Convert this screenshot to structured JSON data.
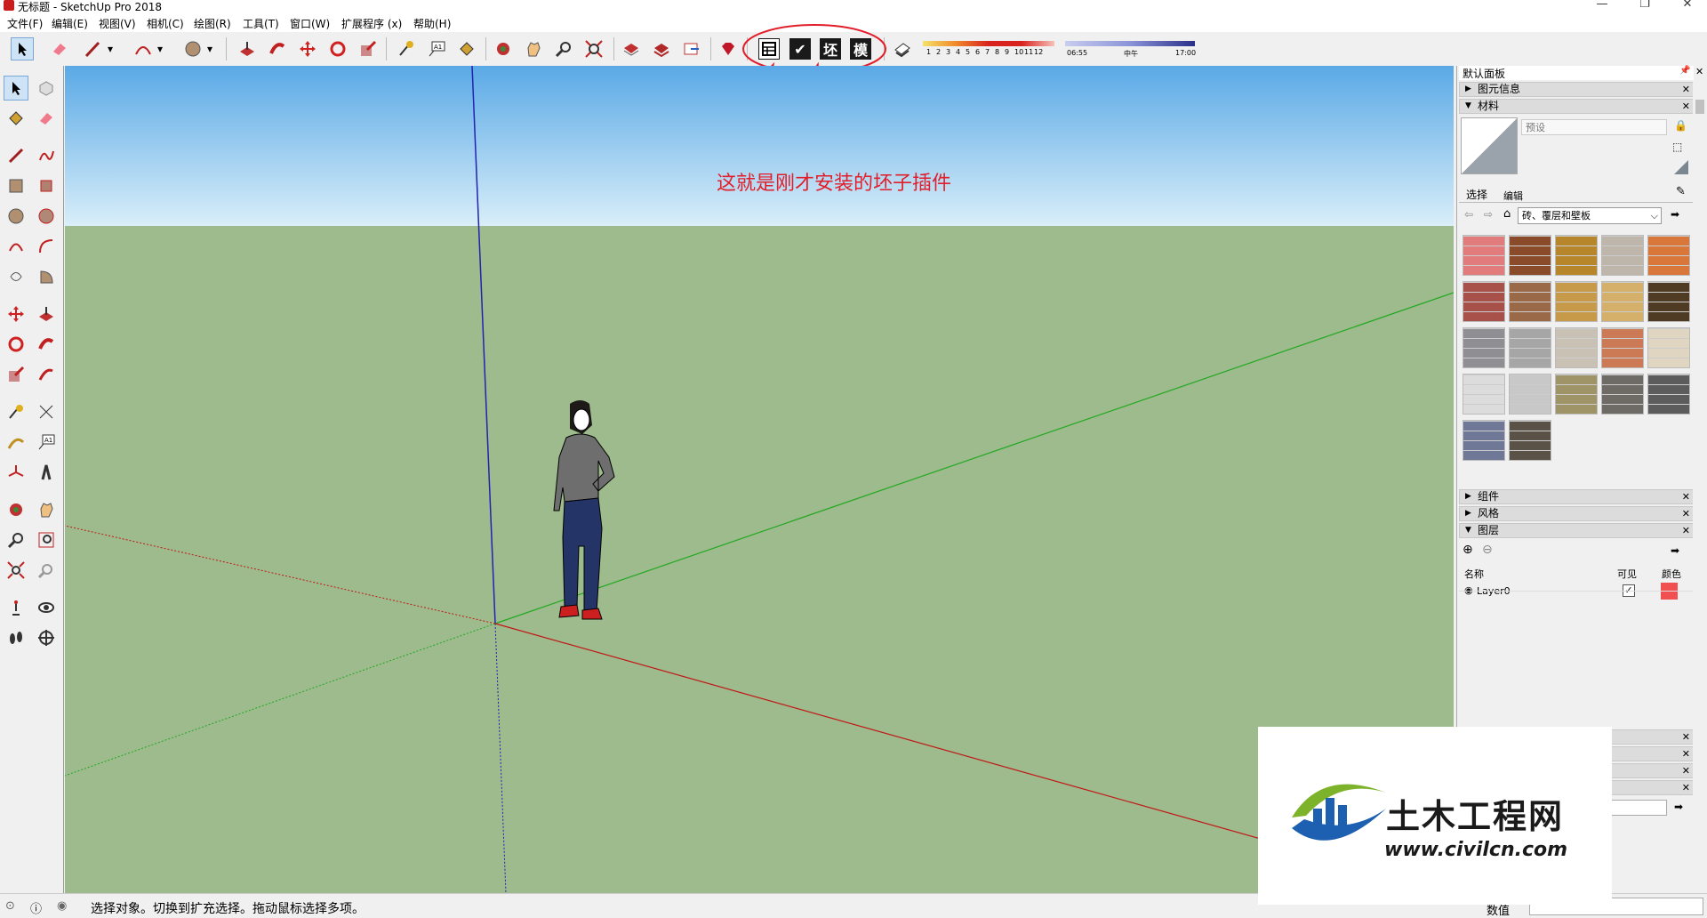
{
  "window": {
    "title": "无标题 - SketchUp Pro 2018"
  },
  "menubar": {
    "items": [
      "文件(F)",
      "编辑(E)",
      "视图(V)",
      "相机(C)",
      "绘图(R)",
      "工具(T)",
      "窗口(W)",
      "扩展程序 (x)",
      "帮助(H)"
    ]
  },
  "toolbar": {
    "plugin_buttons": [
      "坯",
      "模"
    ],
    "shadow_months": [
      "1",
      "2",
      "3",
      "4",
      "5",
      "6",
      "7",
      "8",
      "9",
      "10",
      "11",
      "12"
    ],
    "shadow_time_start": "06:55",
    "shadow_time_mid": "中午",
    "shadow_time_end": "17:00"
  },
  "annotation": {
    "text": "这就是刚才安装的坯子插件",
    "color": "#e21e2a"
  },
  "tray": {
    "title": "默认面板",
    "entity_info": "图元信息",
    "materials": {
      "title": "材料",
      "name_placeholder": "预设",
      "tab_select": "选择",
      "tab_edit": "编辑",
      "library": "砖、覆层和壁板"
    },
    "components": "组件",
    "styles": "风格",
    "layers": {
      "title": "图层",
      "col_name": "名称",
      "col_visible": "可见",
      "col_color": "颜色",
      "rows": [
        {
          "name": "Layer0",
          "visible": true,
          "color": "#f05050"
        }
      ]
    }
  },
  "statusbar": {
    "message": "选择对象。切换到扩充选择。拖动鼠标选择多项。",
    "measure_label": "数值"
  },
  "watermark": {
    "brand": "土木工程网",
    "url": "www.civilcn.com"
  },
  "colors": {
    "ground": "#9dbb8c",
    "sky_top": "#5aa9e6",
    "axis_red": "#c01818",
    "axis_green": "#22a822",
    "axis_blue": "#2222b0"
  }
}
